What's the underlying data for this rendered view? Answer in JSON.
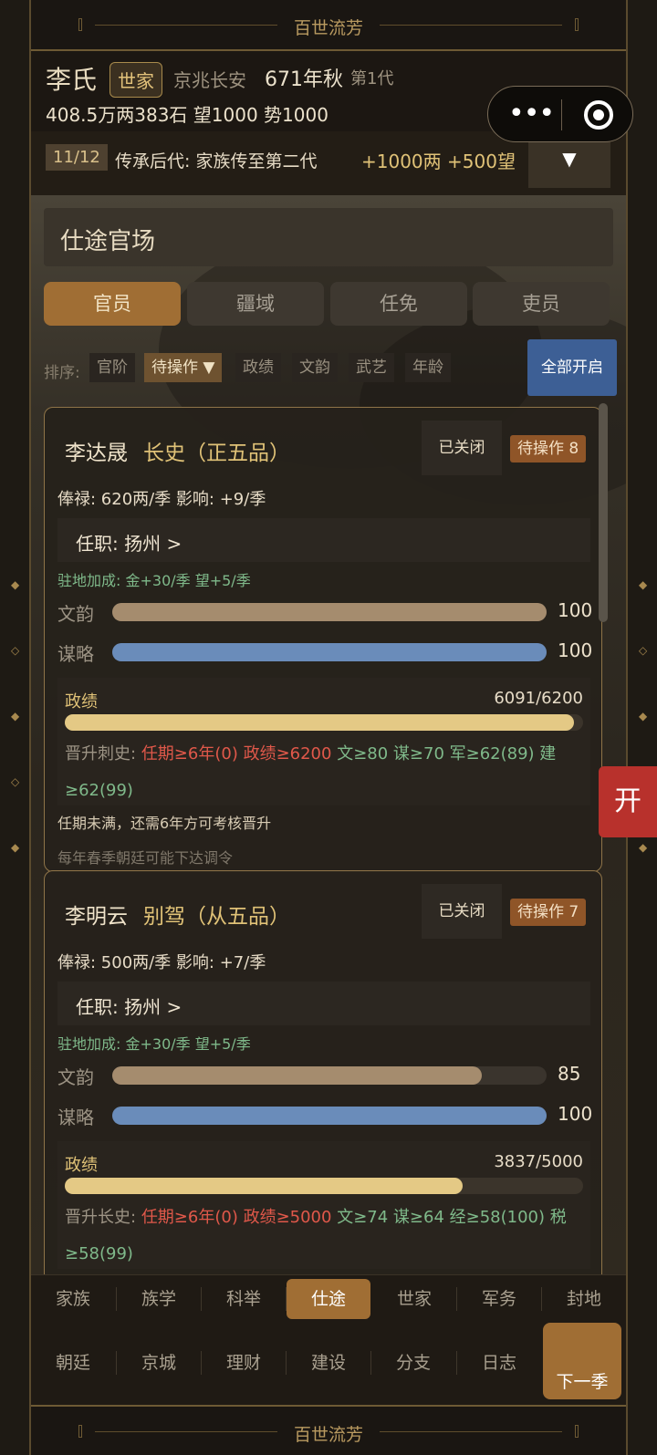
{
  "app": {
    "title": "百世流芳"
  },
  "header": {
    "family": "李氏",
    "tag": "世家",
    "location": "京兆长安",
    "season": "671年秋",
    "generation": "第1代",
    "resources": "408.5万两383石  望1000 势1000"
  },
  "task": {
    "count": "11/12",
    "desc": "传承后代: 家族传至第二代",
    "reward": "+1000两 +500望",
    "dropdown": "▼"
  },
  "section": {
    "title": "仕途官场"
  },
  "tabs": [
    "官员",
    "疆域",
    "任免",
    "吏员"
  ],
  "sort": {
    "label": "排序:",
    "chips": [
      "官阶",
      "待操作 ▼",
      "政绩",
      "文韵",
      "武艺",
      "年龄"
    ],
    "open_all": "全部开启"
  },
  "officials": [
    {
      "name": "李达晟",
      "position": "长史（正五品）",
      "closed": "已关闭",
      "pending": "待操作 8",
      "pay": "俸禄: 620两/季   影响: +9/季",
      "post": "任职: 扬州  >",
      "bonus": "驻地加成: 金+30/季  望+5/季",
      "stats": [
        {
          "label": "文韵",
          "value": 100,
          "max": 100,
          "color": "#a58c6e"
        },
        {
          "label": "谋略",
          "value": 100,
          "max": 100,
          "color": "#6a8cba"
        }
      ],
      "perf_label": "政绩",
      "perf_text": "6091/6200",
      "perf_value": 6091,
      "perf_max": 6200,
      "req_prefix": "晋升刺史:",
      "req_red": "任期≥6年(0)  政绩≥6200",
      "req_green": "文≥80  谋≥70  军≥62(89)  建≥62(99)",
      "note1": "任期未满，还需6年方可考核晋升",
      "note2": "每年春季朝廷可能下达调令"
    },
    {
      "name": "李明云",
      "position": "别驾（从五品）",
      "closed": "已关闭",
      "pending": "待操作 7",
      "pay": "俸禄: 500两/季   影响: +7/季",
      "post": "任职: 扬州  >",
      "bonus": "驻地加成: 金+30/季  望+5/季",
      "stats": [
        {
          "label": "文韵",
          "value": 85,
          "max": 100,
          "color": "#a58c6e"
        },
        {
          "label": "谋略",
          "value": 100,
          "max": 100,
          "color": "#6a8cba"
        }
      ],
      "perf_label": "政绩",
      "perf_text": "3837/5000",
      "perf_value": 3837,
      "perf_max": 5000,
      "req_prefix": "晋升长史:",
      "req_red": "任期≥6年(0)  政绩≥5000",
      "req_green": "文≥74  谋≥64  经≥58(100)  税≥58(99)",
      "note1": "",
      "note2": ""
    }
  ],
  "side_button": "开",
  "nav": {
    "row1": [
      "家族",
      "族学",
      "科举",
      "仕途",
      "世家",
      "军务",
      "封地"
    ],
    "row2": [
      "朝廷",
      "京城",
      "理财",
      "建设",
      "分支",
      "日志"
    ],
    "active": "仕途",
    "next": "下一季"
  },
  "colors": {
    "accent": "#a06e34",
    "gold": "#e0c277",
    "red": "#e0584a",
    "green": "#7fb98a",
    "blue": "#3d5f95"
  }
}
